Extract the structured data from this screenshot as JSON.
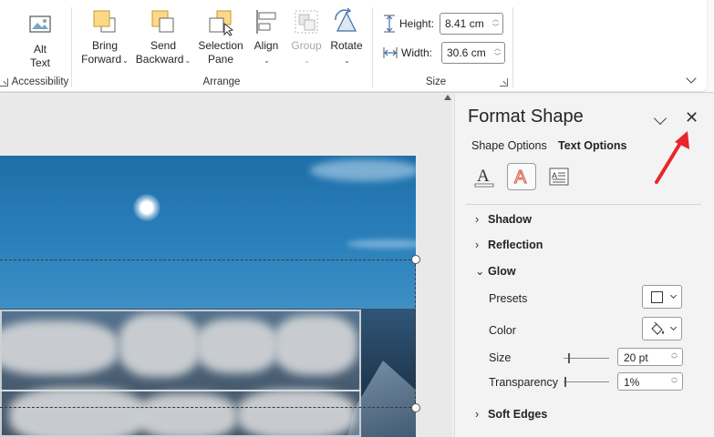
{
  "ribbon": {
    "accessibility": {
      "alt_text_label": "Alt\nText",
      "group_label": "Accessibility"
    },
    "arrange": {
      "group_label": "Arrange",
      "bring_forward": "Bring\nForward",
      "send_backward": "Send\nBackward",
      "selection_pane": "Selection\nPane",
      "align": "Align",
      "group": "Group",
      "rotate": "Rotate"
    },
    "size": {
      "group_label": "Size",
      "height_label": "Height:",
      "height_value": "8.41 cm",
      "width_label": "Width:",
      "width_value": "30.6 cm"
    }
  },
  "pane": {
    "title": "Format Shape",
    "tabs": [
      {
        "label": "Shape Options",
        "active": false
      },
      {
        "label": "Text Options",
        "active": true
      }
    ],
    "subicons": [
      "text-fill-outline-icon",
      "text-effects-icon",
      "textbox-icon"
    ],
    "sections": {
      "shadow": "Shadow",
      "reflection": "Reflection",
      "glow": "Glow",
      "soft_edges": "Soft Edges"
    },
    "glow": {
      "presets_label": "Presets",
      "color_label": "Color",
      "size_label": "Size",
      "size_value": "20 pt",
      "size_level": 0.1,
      "transparency_label": "Transparency",
      "transparency_value": "1%",
      "transparency_level": 0.01
    }
  },
  "colors": {
    "annotation_arrow": "#e8262b",
    "ribbon_icon_fill": "#fbd987",
    "accent": "#e8262b"
  }
}
